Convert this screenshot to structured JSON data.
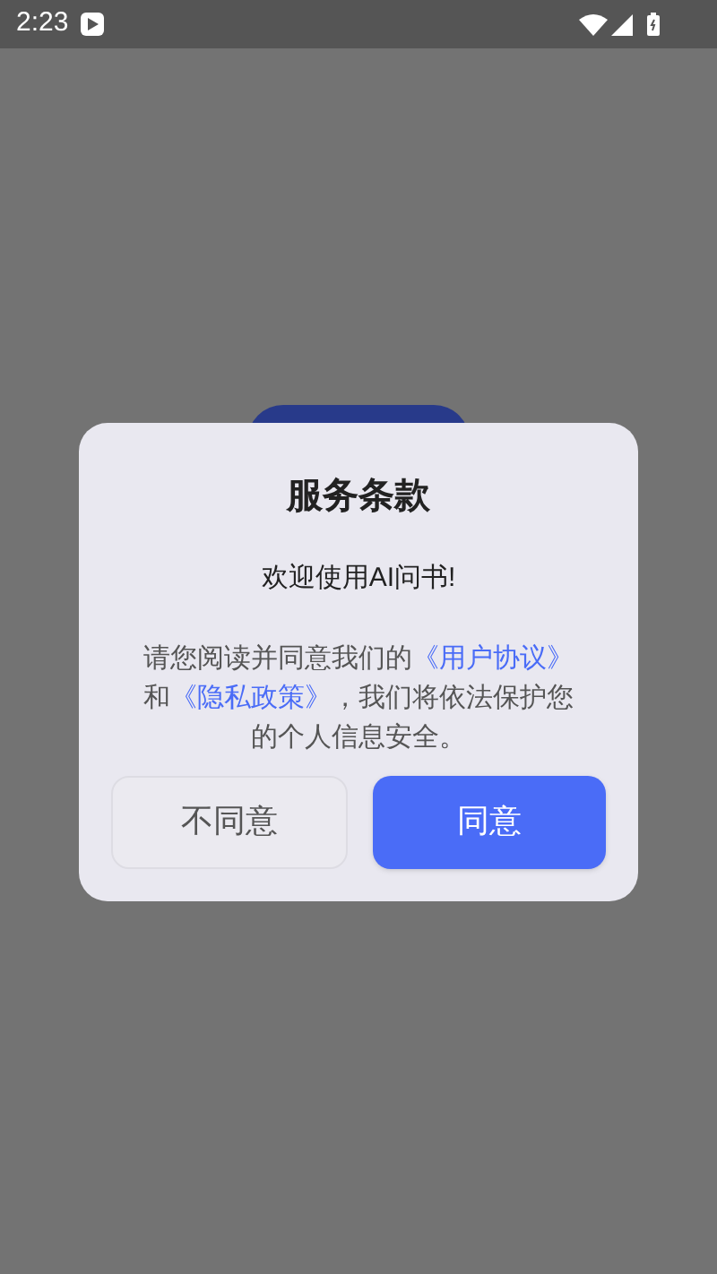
{
  "status_bar": {
    "time": "2:23"
  },
  "dialog": {
    "title": "服务条款",
    "welcome": "欢迎使用AI问书!",
    "notice": {
      "before": "请您阅读并同意我们的",
      "link_1": "《用户协议》",
      "middle": "和",
      "link_2": "《隐私政策》",
      "after": "，我们将依法保护您的个人信息安全。"
    },
    "buttons": [
      {
        "label": "不同意",
        "kind": "secondary"
      },
      {
        "label": "同意",
        "kind": "primary"
      }
    ]
  }
}
